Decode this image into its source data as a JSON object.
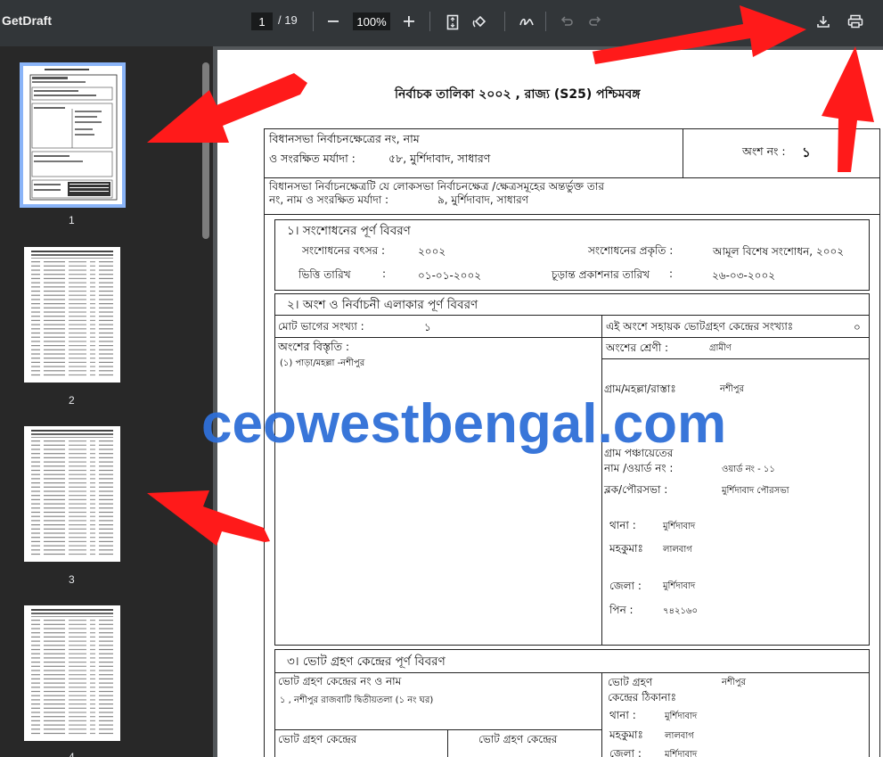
{
  "toolbar": {
    "title": "GetDraft",
    "page_current": "1",
    "page_total": "/ 19",
    "zoom": "100%"
  },
  "sidebar": {
    "thumbnails": [
      {
        "label": "1",
        "selected": true
      },
      {
        "label": "2",
        "selected": false
      },
      {
        "label": "3",
        "selected": false
      },
      {
        "label": "4",
        "selected": false
      }
    ]
  },
  "doc": {
    "heading": "নির্বাচক তালিকা  ২০০২ , রাজ্য (S25) পশ্চিমবঙ্গ",
    "ac_line1": "বিধানসভা নির্বাচনক্ষেত্রের নং, নাম",
    "ac_line2_label": "ও সংরক্ষিত মর্যাদা :",
    "ac_line2_value": "৫৮, মুর্শিদাবাদ, সাধারণ",
    "part_no_label": "অংশ নং :",
    "part_no_value": "১",
    "pc_line1": "বিধানসভা নির্বাচনক্ষেত্রটি যে লোকসভা নির্বাচনক্ষেত্র /ক্ষেত্রসমূহের অন্তর্ভুক্ত তার",
    "pc_line2_label": "নং, নাম  ও সংরক্ষিত মর্যাদা :",
    "pc_line2_value": "৯, মুর্শিদাবাদ, সাধারণ",
    "sec1_title": "১। সংশোধনের পূর্ণ বিবরণ",
    "rev_year_label": "সংশোধনের বৎসর :",
    "rev_year_value": "২০০২",
    "rev_type_label": "সংশোধনের প্রকৃতি :",
    "rev_type_value": "আমূল বিশেষ সংশোধন, ২০০২",
    "qual_date_label": "ভিত্তি তারিখ",
    "qual_date_colon": ":",
    "qual_date_value": "০১-০১-২০০২",
    "pub_date_label": "চূড়ান্ত প্রকাশনার তারিখ",
    "pub_date_colon": ":",
    "pub_date_value": "২৬-০৩-২০০২",
    "sec2_title": "২। অংশ ও নির্বাচনী এলাকার পূর্ণ বিবরণ",
    "sections_count_label": "মোট ভাগের সংখ্যা :",
    "sections_count_value": "১",
    "aux_count_label": "এই অংশে সহায়ক ভোটগ্রহণ কেন্দ্রের সংখ্যাঃ",
    "aux_count_value": "০",
    "extent_label": "অংশের বিস্তৃতি  :",
    "extent_value": "(১) পাড়া/মহল্লা -নশীপুর",
    "category_label": "অংশের শ্রেণী :",
    "category_value": "গ্রামীণ",
    "village_label": "গ্রাম/মহল্লা/রাস্তাঃ",
    "village_value": "নশীপুর",
    "gp_label_1": "গ্রাম পঞ্চায়েতের",
    "gp_label_2": "নাম /ওয়ার্ড নং  :",
    "gp_value": "ওয়ার্ড নং - ১১",
    "block_label": "ব্লক/পৌরসভা   :",
    "block_value": "মুর্শিদাবাদ পৌরসভা",
    "ps_label": "থানা  :",
    "ps_value": "মুর্শিদাবাদ",
    "subdiv_label": "মহকুমাঃ",
    "subdiv_value": "লালবাগ",
    "district_label": "জেলা  :",
    "district_value": "মুর্শিদাবাদ",
    "pin_label": "পিন  :",
    "pin_value": "৭৪২১৬০",
    "sec3_title": "৩। ভোট গ্রহণ কেন্দ্রের পূর্ণ বিবরণ",
    "ps_name_label": "ভোট গ্রহণ কেন্দ্রের নং ও নাম",
    "ps_name_value": "১ , নশীপুর রাজবাটি দ্বিতীয়তলা (১ নং ঘর)",
    "ps_addr_label_1": "ভোট গ্রহণ",
    "ps_addr_label_2": "কেন্দ্রের ঠিকানাঃ",
    "ps_addr_value": "নশীপুর",
    "ps3_thana_label": "থানা  :",
    "ps3_thana_value": "মুর্শিদাবাদ",
    "ps3_subdiv_label": "মহকুমাঃ",
    "ps3_subdiv_value": "লালবাগ",
    "ps3_district_label": "জেলা  :",
    "ps3_district_value": "মুর্শিদাবাদ",
    "ps_type_label_a": "ভোট গ্রহণ কেন্দ্রের",
    "ps_type_label_b": "ভোট গ্রহণ কেন্দ্রের"
  },
  "watermark": "ceowestbengal.com",
  "colors": {
    "toolbar_bg": "#323639",
    "viewer_bg": "#525659",
    "sidebar_bg": "#282828",
    "selection": "#8ab4f8",
    "watermark": "#2f6fd8",
    "arrow": "#ff1a1a"
  },
  "icons": [
    "zoom-out-icon",
    "zoom-in-icon",
    "fit-page-icon",
    "rotate-icon",
    "annotate-icon",
    "undo-icon",
    "redo-icon",
    "download-icon",
    "print-icon"
  ]
}
